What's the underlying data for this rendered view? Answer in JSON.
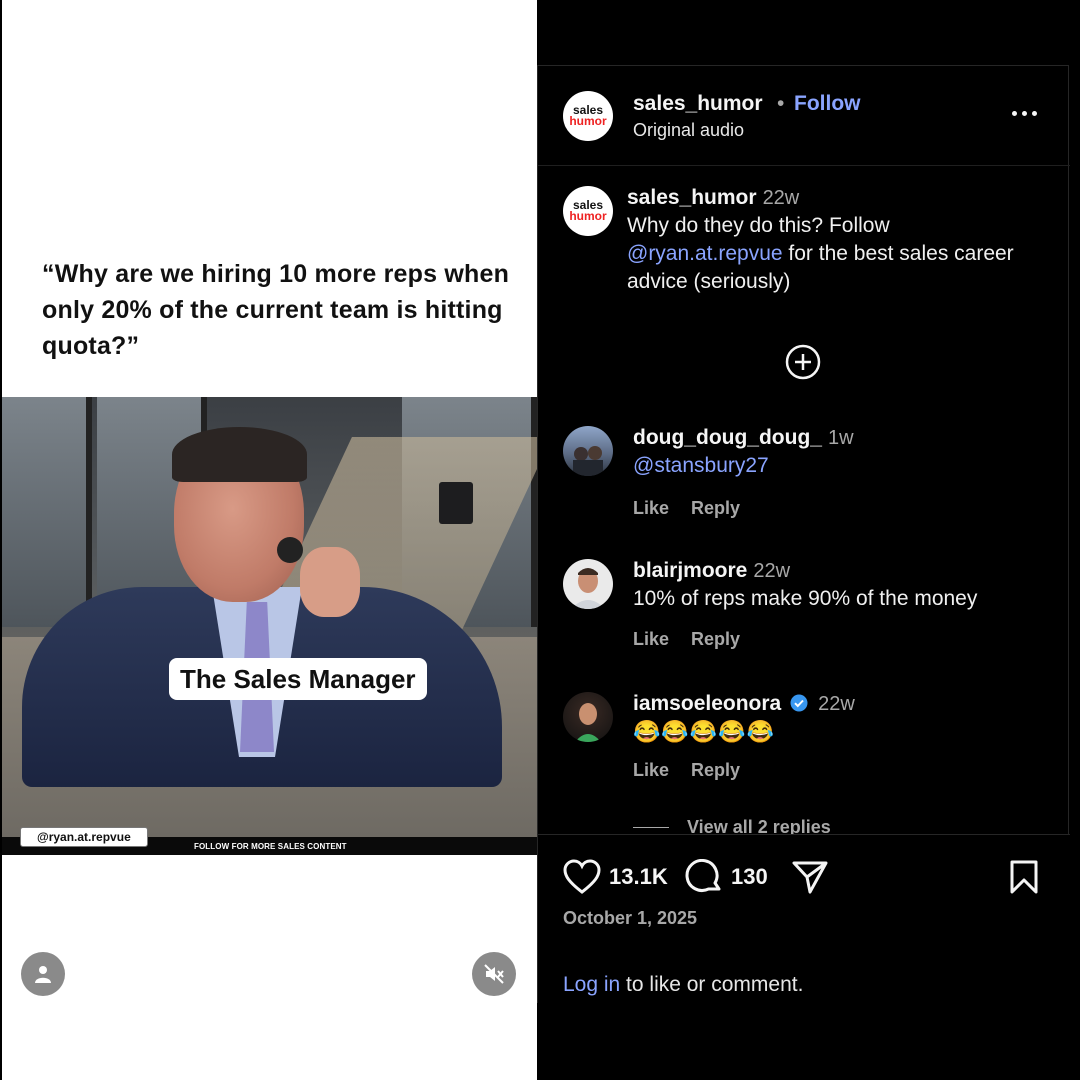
{
  "video": {
    "caption": "“Why are we hiring 10 more reps when only 20% of the current team is hitting quota?”",
    "overlay_label": "The Sales Manager",
    "handle_badge": "@ryan.at.repvue",
    "footer_text": "FOLLOW FOR MORE SALES CONTENT",
    "profile_icon": "user-icon",
    "mute_icon": "muted-speaker-icon"
  },
  "header": {
    "avatar_text_top": "sales",
    "avatar_text_bottom": "humor",
    "username": "sales_humor",
    "separator": "•",
    "follow_label": "Follow",
    "audio_label": "Original audio",
    "more_icon": "more-horizontal-icon"
  },
  "post_caption": {
    "username": "sales_humor",
    "time": "22w",
    "text_before": "Why do they do this? Follow ",
    "mention": "@ryan.at.repvue",
    "text_after": " for the best sales career advice (seriously)"
  },
  "load_more_icon": "plus-circle-icon",
  "comments": [
    {
      "username": "doug_doug_doug_",
      "time": "1w",
      "mention": "@stansbury27",
      "text": "",
      "like_label": "Like",
      "reply_label": "Reply"
    },
    {
      "username": "blairjmoore",
      "time": "22w",
      "mention": "",
      "text": "10% of reps make 90% of the money",
      "like_label": "Like",
      "reply_label": "Reply"
    },
    {
      "username": "iamsoeleonora",
      "verified": true,
      "time": "22w",
      "mention": "",
      "text": "😂😂😂😂😂",
      "like_label": "Like",
      "reply_label": "Reply"
    }
  ],
  "view_replies_label": "View all 2 replies",
  "actions": {
    "like_count": "13.1K",
    "comment_count": "130",
    "like_icon": "heart-icon",
    "comment_icon": "comment-icon",
    "share_icon": "send-icon",
    "save_icon": "bookmark-icon"
  },
  "date": "October 1, 2025",
  "login": {
    "link": "Log in",
    "rest": " to like or comment."
  },
  "colors": {
    "accent_link": "#8aa4ff",
    "background": "#000000",
    "muted_text": "#a8a8a8"
  }
}
